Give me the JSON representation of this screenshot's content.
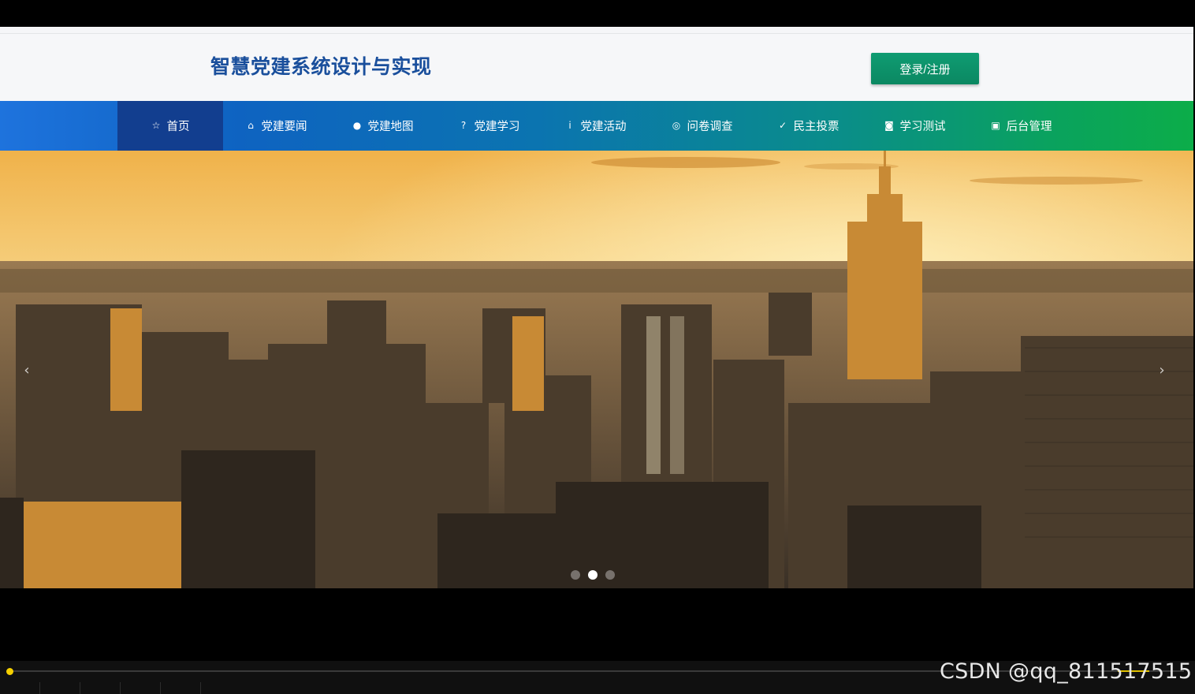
{
  "site": {
    "title": "智慧党建系统设计与实现",
    "login_label": "登录/注册"
  },
  "nav": {
    "items": [
      {
        "label": "首页",
        "icon": "star-icon",
        "glyph": "☆",
        "active": true
      },
      {
        "label": "党建要闻",
        "icon": "bag-icon",
        "glyph": "⌂",
        "active": false
      },
      {
        "label": "党建地图",
        "icon": "info-icon",
        "glyph": "●",
        "active": false
      },
      {
        "label": "党建学习",
        "icon": "question-icon",
        "glyph": "?",
        "active": false
      },
      {
        "label": "党建活动",
        "icon": "info-circle-icon",
        "glyph": "i",
        "active": false
      },
      {
        "label": "问卷调查",
        "icon": "settings-circle-icon",
        "glyph": "◎",
        "active": false
      },
      {
        "label": "民主投票",
        "icon": "check-circle-icon",
        "glyph": "✓",
        "active": false
      },
      {
        "label": "学习测试",
        "icon": "camera-icon",
        "glyph": "◙",
        "active": false
      },
      {
        "label": "后台管理",
        "icon": "gift-icon",
        "glyph": "▣",
        "active": false
      }
    ]
  },
  "carousel": {
    "prev_glyph": "‹",
    "next_glyph": "›",
    "slide_count": 3,
    "active_index": 1
  },
  "watermark": "CSDN @qq_811517515",
  "colors": {
    "title": "#1a4f9c",
    "login_button": "#0f9c72",
    "nav_active": "#123e8f",
    "nav_gradient_start": "#1e73dd",
    "nav_gradient_end": "#0cad49"
  }
}
